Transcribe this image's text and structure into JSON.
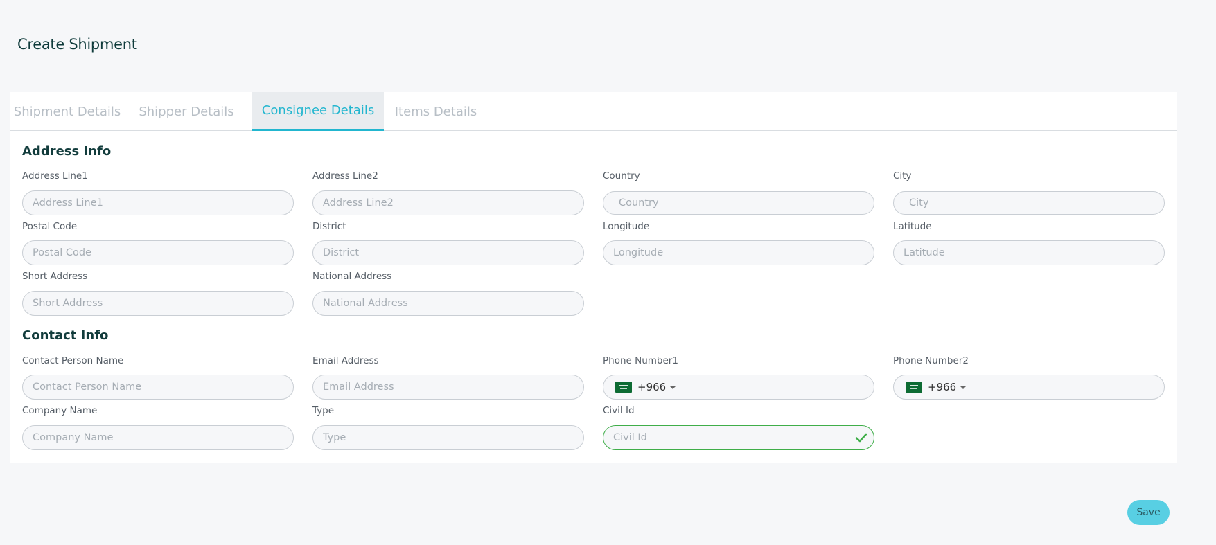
{
  "page": {
    "title": "Create Shipment"
  },
  "tabs": [
    {
      "label": "Shipment Details",
      "active": false
    },
    {
      "label": "Shipper Details",
      "active": false
    },
    {
      "label": "Consignee Details",
      "active": true
    },
    {
      "label": "Items Details",
      "active": false
    }
  ],
  "address_info": {
    "title": "Address Info",
    "fields": {
      "address_line1": {
        "label": "Address Line1",
        "placeholder": "Address Line1",
        "value": ""
      },
      "address_line2": {
        "label": "Address Line2",
        "placeholder": "Address Line2",
        "value": ""
      },
      "country": {
        "label": "Country",
        "placeholder": "Country",
        "value": ""
      },
      "city": {
        "label": "City",
        "placeholder": "City",
        "value": ""
      },
      "postal_code": {
        "label": "Postal Code",
        "placeholder": "Postal Code",
        "value": ""
      },
      "district": {
        "label": "District",
        "placeholder": "District",
        "value": ""
      },
      "longitude": {
        "label": "Longitude",
        "placeholder": "Longitude",
        "value": ""
      },
      "latitude": {
        "label": "Latitude",
        "placeholder": "Latitude",
        "value": ""
      },
      "short_address": {
        "label": "Short Address",
        "placeholder": "Short Address",
        "value": ""
      },
      "national_address": {
        "label": "National Address",
        "placeholder": "National Address",
        "value": ""
      }
    }
  },
  "contact_info": {
    "title": "Contact Info",
    "fields": {
      "contact_person_name": {
        "label": "Contact Person Name",
        "placeholder": "Contact Person Name",
        "value": ""
      },
      "email_address": {
        "label": "Email Address",
        "placeholder": "Email Address",
        "value": ""
      },
      "phone_number1": {
        "label": "Phone Number1",
        "dial_code": "+966",
        "flag": "saudi-arabia-flag-icon"
      },
      "phone_number2": {
        "label": "Phone Number2",
        "dial_code": "+966",
        "flag": "saudi-arabia-flag-icon"
      },
      "company_name": {
        "label": "Company Name",
        "placeholder": "Company Name",
        "value": ""
      },
      "type": {
        "label": "Type",
        "placeholder": "Type",
        "value": ""
      },
      "civil_id": {
        "label": "Civil Id",
        "placeholder": "Civil Id",
        "value": "",
        "status": "valid"
      }
    }
  },
  "actions": {
    "save_label": "Save"
  },
  "colors": {
    "accent": "#22b6cf",
    "save_button": "#58cfe3",
    "valid": "#3fae49",
    "heading": "#123c3c",
    "background": "#f6f7f9"
  }
}
